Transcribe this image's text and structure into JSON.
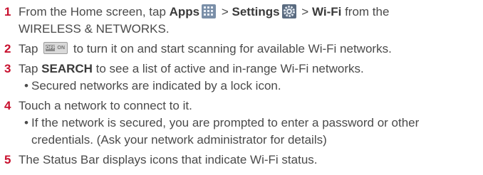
{
  "steps": [
    {
      "number": "1",
      "parts": {
        "a": "From the Home screen, tap ",
        "apps": "Apps",
        "sep1": " > ",
        "settings": "Settings",
        "sep2": " > ",
        "wifi": "Wi-Fi",
        "b": " from the"
      },
      "cont": "WIRELESS & NETWORKS."
    },
    {
      "number": "2",
      "a": "Tap ",
      "toggle": {
        "off": "OFF",
        "on": "ON"
      },
      "b": " to turn it on and start scanning for available Wi-Fi networks."
    },
    {
      "number": "3",
      "a": "Tap ",
      "search": "SEARCH",
      "b": " to see a list of active and in-range Wi-Fi networks.",
      "bullet": "Secured networks are indicated by a lock icon."
    },
    {
      "number": "4",
      "text": "Touch a network to connect to it.",
      "bullet": "If the network is secured, you are prompted to enter a password or other",
      "bullet_cont": "credentials. (Ask your network administrator for details)"
    },
    {
      "number": "5",
      "text": "The Status Bar displays icons that indicate Wi-Fi status."
    }
  ],
  "bullet_char": "•",
  "icons": {
    "apps": "apps-grid-icon",
    "settings": "settings-gear-icon",
    "toggle": "wifi-toggle-icon"
  },
  "colors": {
    "step_number": "#c8102e",
    "text": "#4a4a4a"
  }
}
